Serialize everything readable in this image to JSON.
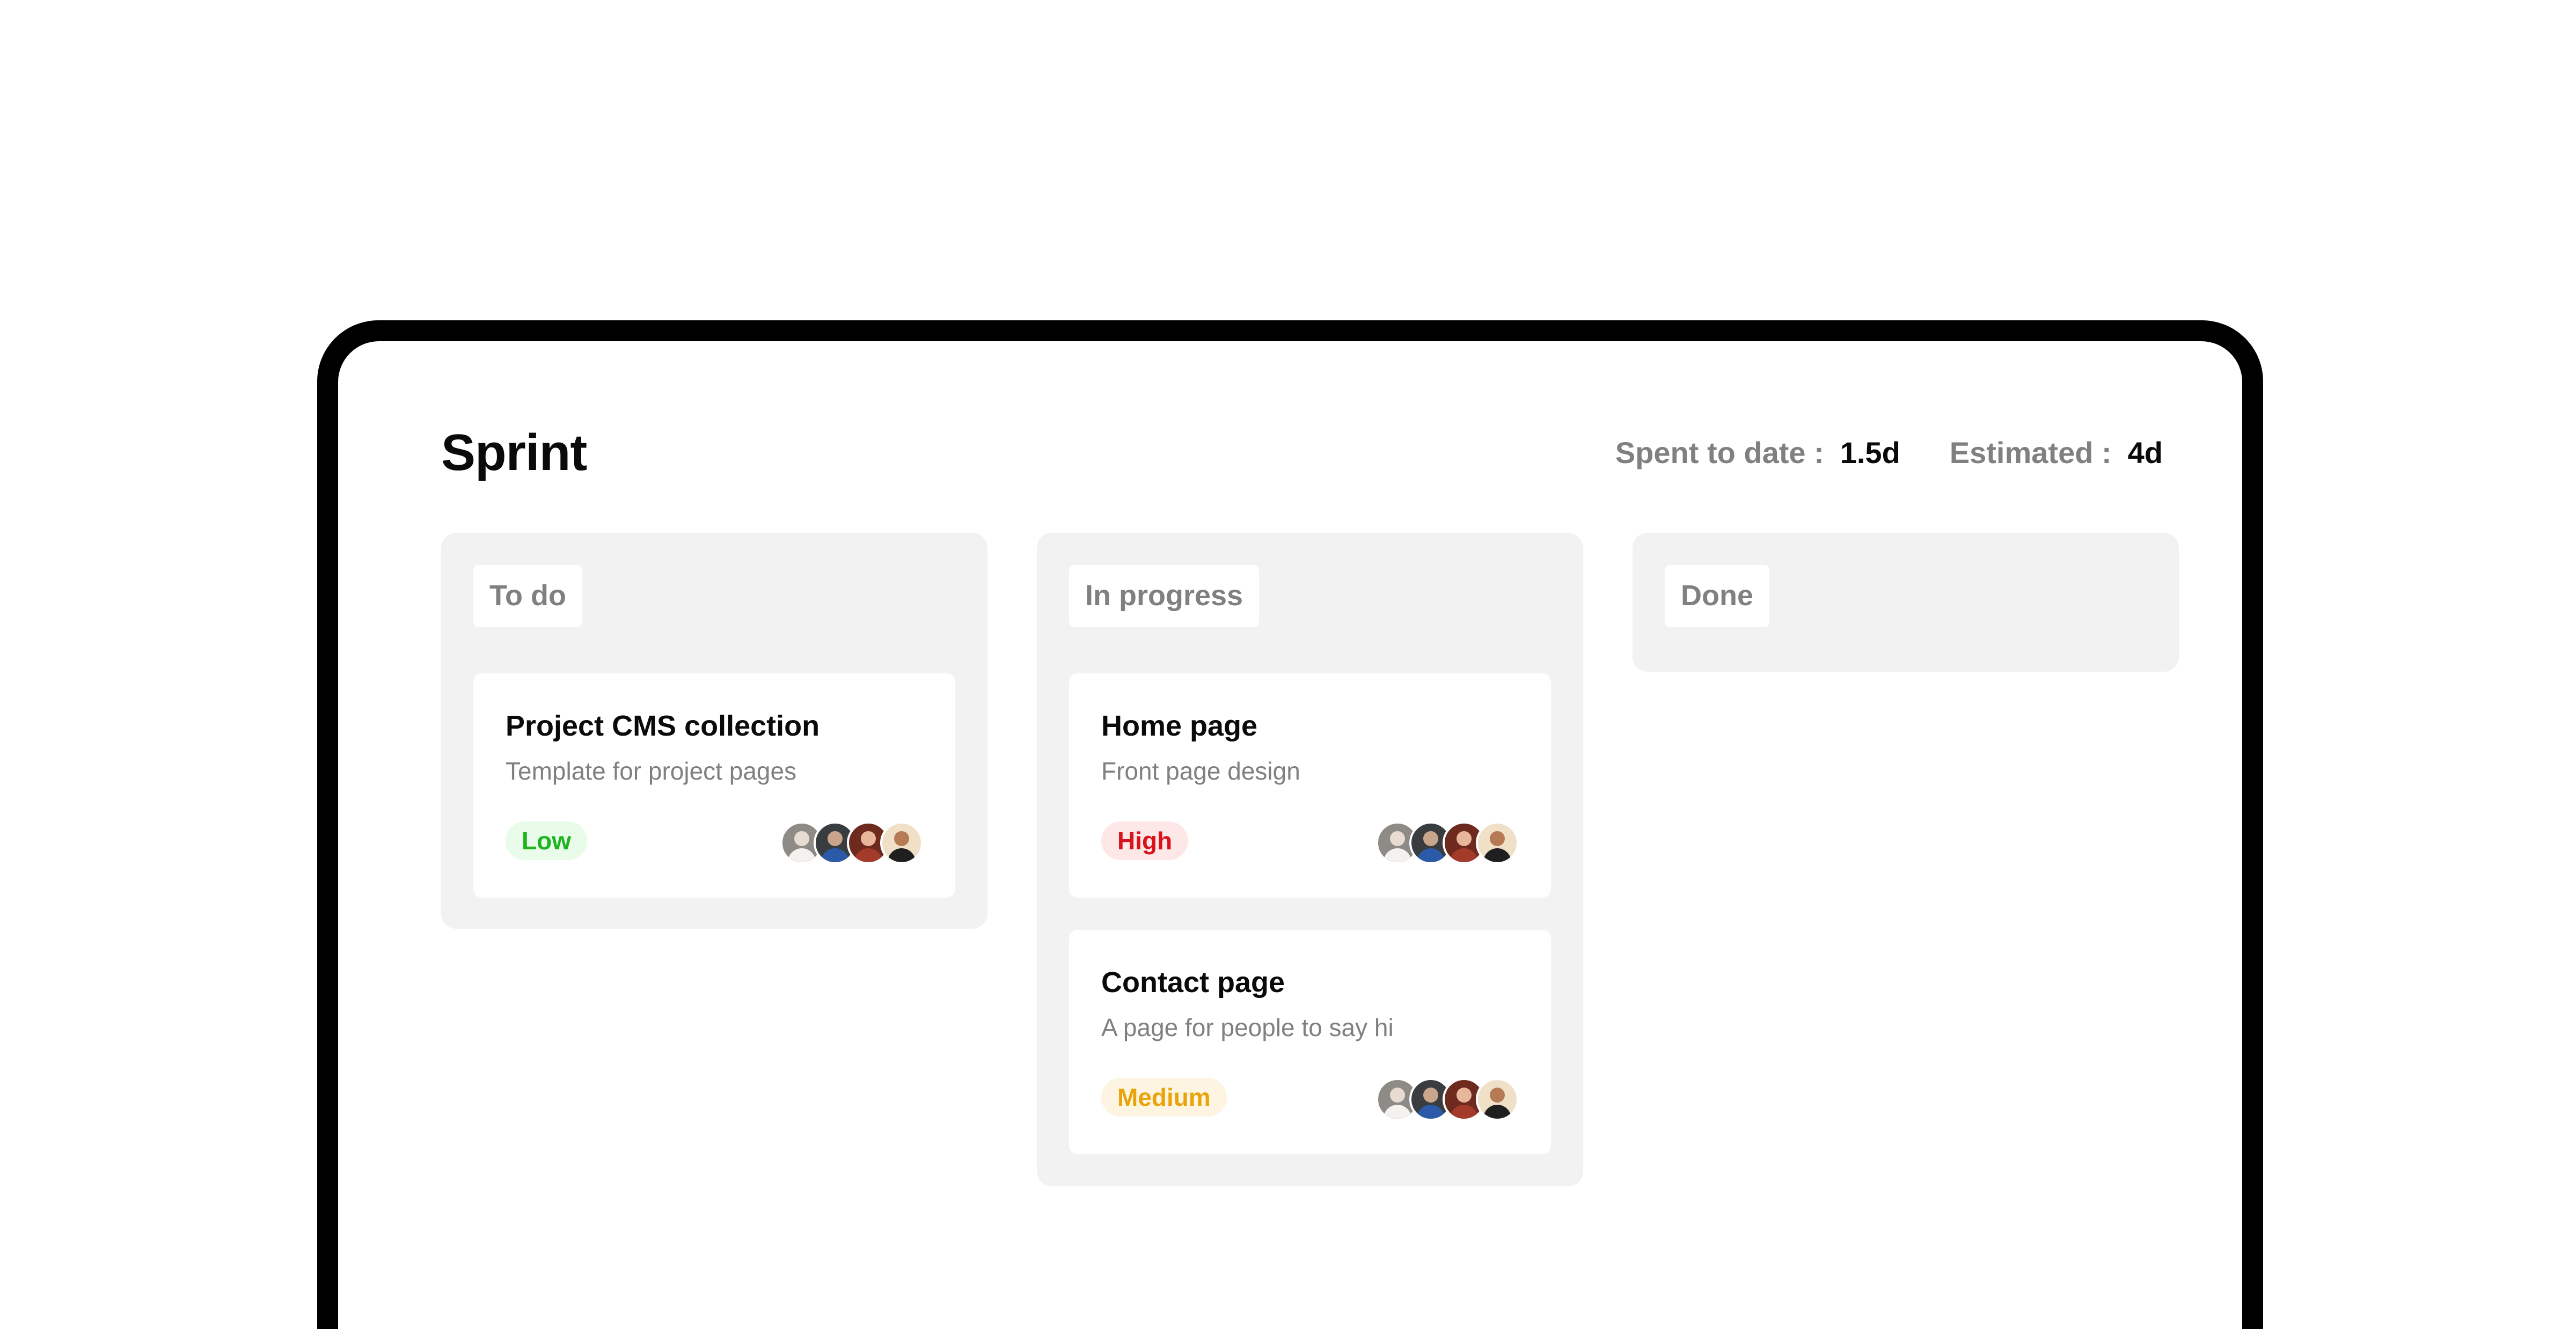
{
  "page": {
    "title": "Sprint",
    "stats": {
      "spent_label": "Spent to date :",
      "spent_value": "1.5d",
      "estimated_label": "Estimated :",
      "estimated_value": "4d"
    }
  },
  "columns": [
    {
      "label": "To do",
      "cards": [
        {
          "title": "Project CMS collection",
          "description": "Template for project pages",
          "priority": "Low",
          "priority_color": "#1cb51c",
          "assignees": [
            "avatar-1",
            "avatar-2",
            "avatar-3",
            "avatar-4"
          ]
        }
      ]
    },
    {
      "label": "In progress",
      "cards": [
        {
          "title": "Home page",
          "description": "Front page design",
          "priority": "High",
          "priority_color": "#d9121b",
          "assignees": [
            "avatar-1",
            "avatar-2",
            "avatar-3",
            "avatar-4"
          ]
        },
        {
          "title": "Contact page",
          "description": "A page for people to say hi",
          "priority": "Medium",
          "priority_color": "#e9a40a",
          "assignees": [
            "avatar-1",
            "avatar-2",
            "avatar-3",
            "avatar-4"
          ]
        }
      ]
    },
    {
      "label": "Done",
      "cards": []
    }
  ],
  "colors": {
    "column_background": "#f2f2f2",
    "muted_text": "#808080",
    "device_frame": "#000000"
  }
}
